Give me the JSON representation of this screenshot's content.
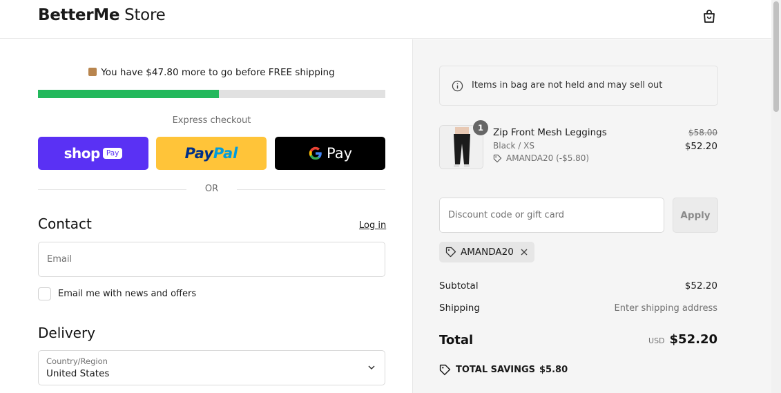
{
  "header": {
    "logo_bold": "BetterMe",
    "logo_light": " Store",
    "bag_icon": "shopping-bag-icon"
  },
  "shipping": {
    "message": "You have $47.80 more to go before FREE shipping",
    "progress": 0.52,
    "progress_color": "#23b85c"
  },
  "express": {
    "label": "Express checkout",
    "shop_word": "shop",
    "shop_pill": "Pay",
    "paypal_part1": "Pay",
    "paypal_part2": "Pal",
    "gpay_g": "G",
    "gpay_word": "Pay",
    "or_text": "OR"
  },
  "contact": {
    "title": "Contact",
    "login_label": "Log in",
    "email_placeholder": "Email",
    "newsletter_label": "Email me with news and offers"
  },
  "delivery": {
    "title": "Delivery",
    "country_label": "Country/Region",
    "country_value": "United States"
  },
  "summary": {
    "notice": "Items in bag are not held and may sell out",
    "item": {
      "quantity": "1",
      "name": "Zip Front Mesh Leggings",
      "variant": "Black / XS",
      "discount": "AMANDA20 (-$5.80)",
      "price_original": "$58.00",
      "price_final": "$52.20"
    },
    "discount_placeholder": "Discount code or gift card",
    "apply_label": "Apply",
    "applied_code": "AMANDA20",
    "subtotal_label": "Subtotal",
    "subtotal_value": "$52.20",
    "shipping_label": "Shipping",
    "shipping_value": "Enter shipping address",
    "total_label": "Total",
    "total_currency": "USD",
    "total_value": "$52.20",
    "savings_label": "TOTAL SAVINGS",
    "savings_value": "$5.80"
  },
  "colors": {
    "shop_pay": "#5a31f4",
    "paypal": "#ffc439",
    "gpay": "#000000"
  }
}
